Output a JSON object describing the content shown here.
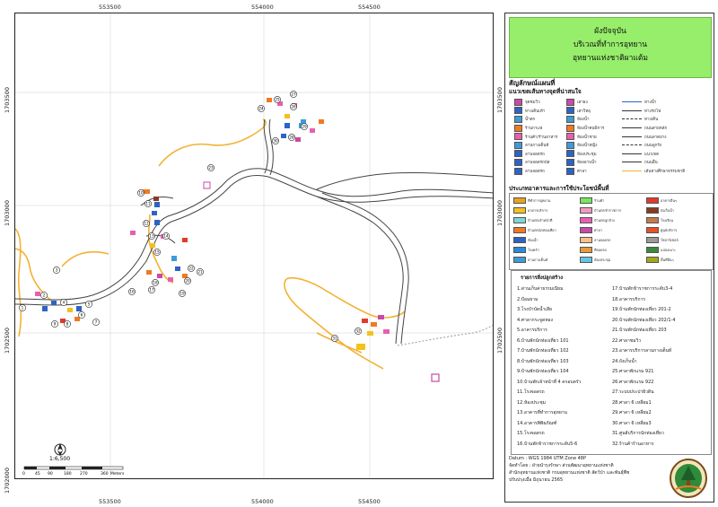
{
  "map": {
    "x_coords": [
      "553500",
      "554000",
      "554500"
    ],
    "y_coords": [
      "1703500",
      "1703000",
      "1702500",
      "1702000"
    ],
    "scale_text": "1:6,500",
    "scale_ticks": [
      "0",
      "45",
      "90",
      "180",
      "270",
      "360"
    ],
    "scale_unit": "Meters",
    "north": "N",
    "site_labels": [
      "1",
      "2",
      "3",
      "4",
      "5",
      "6",
      "7",
      "8",
      "9",
      "10",
      "11",
      "12",
      "13",
      "14",
      "15",
      "16",
      "17",
      "18",
      "19",
      "20",
      "21",
      "22",
      "23",
      "24",
      "25",
      "26",
      "27",
      "28",
      "29",
      "30",
      "31",
      "32"
    ]
  },
  "panel": {
    "title_lines": [
      "ผังปัจจุบัน",
      "บริเวณที่ทำการอุทยาน",
      "อุทยานแห่งชาติผาแต้ม"
    ],
    "legend_heading": "สัญลักษณ์แผนที่",
    "legend_subheading": "แนวเขตเส้นทางจุดที่น่าสนใจ",
    "legend_col1": [
      "จุดชมวิว",
      "ทางเดินเท้า",
      "น้ำตก",
      "ร้านกาแฟ",
      "ร้านค้า/ร้านอาหาร",
      "ลานกางเต็นท์",
      "ลานจอดรถ",
      "ลานจอดรถบัส",
      "ลานจอดรถ"
    ],
    "legend_col2": [
      "เสาธง",
      "เสาวิทยุ",
      "ห้องน้ำ",
      "ห้องน้ำคนพิการ",
      "ห้องน้ำชาย",
      "ห้องน้ำหญิง",
      "ห้องประชุม",
      "ห้องอาบน้ำ",
      "ศาลา"
    ],
    "legend_col3": [
      "ทางน้ำ",
      "ทางรถไฟ",
      "ทางเดิน",
      "ถนนสายหลัก",
      "ถนนลาดยาง",
      "ถนนลูกรัง",
      "แนวเขต",
      "ถนนอื่น",
      "เส้นทางศึกษาธรรมชาติ"
    ],
    "buildings_heading": "ประเภทอาคารและการใช้ประโยชน์พื้นที่",
    "buildings": [
      {
        "label": "ที่ทำการอุทยาน",
        "color": "#e8a21e"
      },
      {
        "label": "อาคารบริการ",
        "color": "#f2c21d"
      },
      {
        "label": "บ้านพักเจ้าหน้าที่",
        "color": "#7fd6d6"
      },
      {
        "label": "บ้านพักนักท่องเที่ยว",
        "color": "#f07a24"
      },
      {
        "label": "ห้องน้ำ",
        "color": "#2c63c4"
      },
      {
        "label": "โรงครัว",
        "color": "#2a8ad8"
      },
      {
        "label": "ลานกางเต็นท์",
        "color": "#3f9bd6"
      },
      {
        "label": "ร้านค้า",
        "color": "#76e85a"
      },
      {
        "label": "บ้านพักข้าราชการ",
        "color": "#f49ac0"
      },
      {
        "label": "บ้านพักลูกจ้าง",
        "color": "#e85fb0"
      },
      {
        "label": "ศาลา",
        "color": "#c84aa6"
      },
      {
        "label": "ลานจอดรถ",
        "color": "#f7c08a"
      },
      {
        "label": "ที่จอดรถ",
        "color": "#e69a3b"
      },
      {
        "label": "ห้องประชุม",
        "color": "#63c6e8"
      },
      {
        "label": "อาคารอื่นๆ",
        "color": "#e23a2a"
      },
      {
        "label": "ถังเก็บน้ำ",
        "color": "#8b3a1e"
      },
      {
        "label": "โรงเรือน",
        "color": "#c97a4a"
      },
      {
        "label": "ศูนย์บริการ",
        "color": "#e8502a"
      },
      {
        "label": "โซลาร์เซลล์",
        "color": "#9a9a9a"
      },
      {
        "label": "แปลงเพาะ",
        "color": "#3a8a3a"
      },
      {
        "label": "พื้นที่อื่นๆ",
        "color": "#a6a61a"
      }
    ],
    "list_heading": "รายการสิ่งปลูกสร้าง",
    "list_col1": [
      "1.ด่านเก็บค่าธรรมเนียม",
      "2.ป้อมยาม",
      "3.โรงบำบัดน้ำเสีย",
      "4.ศาลากระจูดหอง",
      "5.อาคารบริการ",
      "6.บ้านพักนักท่องเที่ยว 101",
      "7.บ้านพักนักท่องเที่ยว 102",
      "8.บ้านพักนักท่องเที่ยว 103",
      "9.บ้านพักนักท่องเที่ยว 104",
      "10.บ้านพักเจ้าหน้าที่ 4 ครอบครัว",
      "11.โรงจอดรถ",
      "12.ห้องประชุม",
      "13.อาคารที่ทำการอุทยาน",
      "14.อาคารพิพิธภัณฑ์",
      "15.โรงจอดรถ",
      "16.บ้านพักข้าราชการระดับ5-6"
    ],
    "list_col2": [
      "17.บ้านพักข้าราชการระดับ3-4",
      "18.อาคารบริการ",
      "19.บ้านพักนักท่องเที่ยว 201-2",
      "20.บ้านพักนักท่องเที่ยว 202/1-4",
      "21.บ้านพักนักท่องเที่ยว 203",
      "22.ศาลาชมวิว",
      "23.อาคารบริการลานกางเต็นท์",
      "24.ถังเก็บน้ำ",
      "25.ศาลาพักแรม 921",
      "26.ศาลาพักแรม 922",
      "27.ระบบประปาผิวดิน",
      "28.ศาลา 6 เหลี่ยม1",
      "29.ศาลา 6 เหลี่ยม2",
      "30.ศาลา 6 เหลี่ยม3",
      "31.ศูนย์บริการนักท่องเที่ยว",
      "32.ร้านค้าร้านอาหาร"
    ],
    "footer_lines": [
      "Datum : WGS 1984 UTM Zone 48P",
      "จัดทำโดย : ฝ่ายนำรุงรักษา ส่วนพัฒนาอุทยานแห่งชาติ",
      "สำนักอุทยานแห่งชาติ กรมอุทยานแห่งชาติ สัตว์ป่า และพันธุ์พืช",
      "ปรับปรุงเมื่อ มิถุนายน 2565"
    ]
  }
}
